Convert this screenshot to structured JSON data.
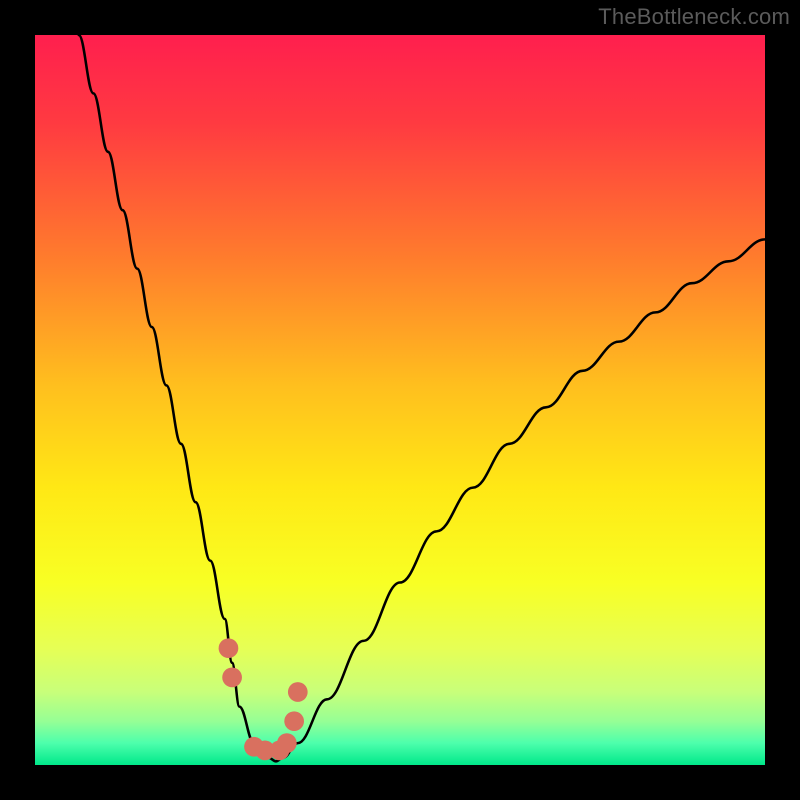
{
  "watermark": "TheBottleneck.com",
  "chart_data": {
    "type": "line",
    "title": "",
    "xlabel": "",
    "ylabel": "",
    "xlim": [
      0,
      100
    ],
    "ylim": [
      0,
      100
    ],
    "series": [
      {
        "name": "bottleneck-curve",
        "x": [
          6,
          8,
          10,
          12,
          14,
          16,
          18,
          20,
          22,
          24,
          26,
          27,
          28,
          30,
          32,
          33,
          34,
          36,
          40,
          45,
          50,
          55,
          60,
          65,
          70,
          75,
          80,
          85,
          90,
          95,
          100
        ],
        "y": [
          100,
          92,
          84,
          76,
          68,
          60,
          52,
          44,
          36,
          28,
          20,
          14,
          8,
          3,
          1,
          0.5,
          1,
          3,
          9,
          17,
          25,
          32,
          38,
          44,
          49,
          54,
          58,
          62,
          66,
          69,
          72
        ]
      }
    ],
    "markers": {
      "name": "highlight-points",
      "x": [
        26.5,
        27.0,
        30.0,
        31.5,
        33.5,
        34.5,
        35.5,
        36.0
      ],
      "y": [
        16.0,
        12.0,
        2.5,
        2.0,
        2.0,
        3.0,
        6.0,
        10.0
      ]
    },
    "gradient_stops": [
      {
        "pos": 0.0,
        "color": "#ff1f4e"
      },
      {
        "pos": 0.12,
        "color": "#ff3a41"
      },
      {
        "pos": 0.3,
        "color": "#ff7a2d"
      },
      {
        "pos": 0.48,
        "color": "#ffbf1e"
      },
      {
        "pos": 0.62,
        "color": "#ffe815"
      },
      {
        "pos": 0.75,
        "color": "#f8ff24"
      },
      {
        "pos": 0.84,
        "color": "#e6ff55"
      },
      {
        "pos": 0.9,
        "color": "#c8ff7a"
      },
      {
        "pos": 0.94,
        "color": "#96ff95"
      },
      {
        "pos": 0.97,
        "color": "#4dffac"
      },
      {
        "pos": 1.0,
        "color": "#00e88a"
      }
    ],
    "marker_color": "#d9705f",
    "curve_color": "#000000"
  }
}
